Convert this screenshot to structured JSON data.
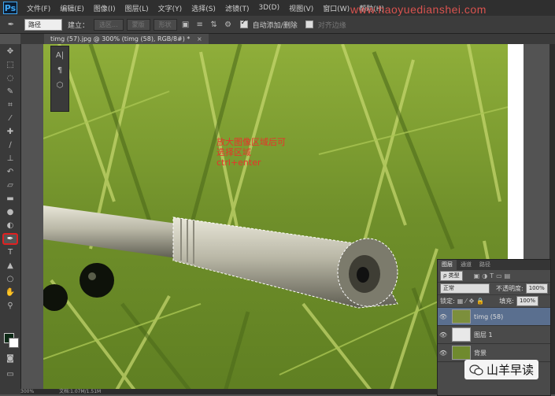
{
  "app": {
    "logo": "Ps"
  },
  "menu": [
    "文件(F)",
    "编辑(E)",
    "图像(I)",
    "图层(L)",
    "文字(Y)",
    "选择(S)",
    "滤镜(T)",
    "3D(D)",
    "视图(V)",
    "窗口(W)",
    "帮助(H)"
  ],
  "watermark": "www.haoyuedianshei.com",
  "options": {
    "mode_value": "路径",
    "make_label": "建立：",
    "selection_btn": "选区...",
    "mask_btn": "蒙版",
    "shape_btn": "形状",
    "auto_add_delete": "自动添加/删除",
    "align_edges": "对齐边缘"
  },
  "document": {
    "tab_title": "timg (57).jpg @ 300% (timg (58), RGB/8#) *"
  },
  "annotation": "放大图像区域后可\n选择区域\nctrl+enter",
  "layers_panel": {
    "tabs": [
      "图层",
      "通道",
      "路径"
    ],
    "filter_kind": "ρ 类型",
    "blend_mode": "正常",
    "opacity_label": "不透明度:",
    "opacity_value": "100%",
    "lock_label": "锁定:",
    "fill_label": "填充:",
    "fill_value": "100%",
    "layers": [
      {
        "name": "timg (58)",
        "selected": true
      },
      {
        "name": "图层 1",
        "selected": false
      },
      {
        "name": "背景",
        "selected": false
      }
    ]
  },
  "status": {
    "zoom": "300%",
    "doc": "文档:1.07M/1.51M"
  },
  "brand_logo": "山羊早读",
  "colors": {
    "foreground": "#0d2a16",
    "background": "#ffffff",
    "accent": "#e02020"
  }
}
